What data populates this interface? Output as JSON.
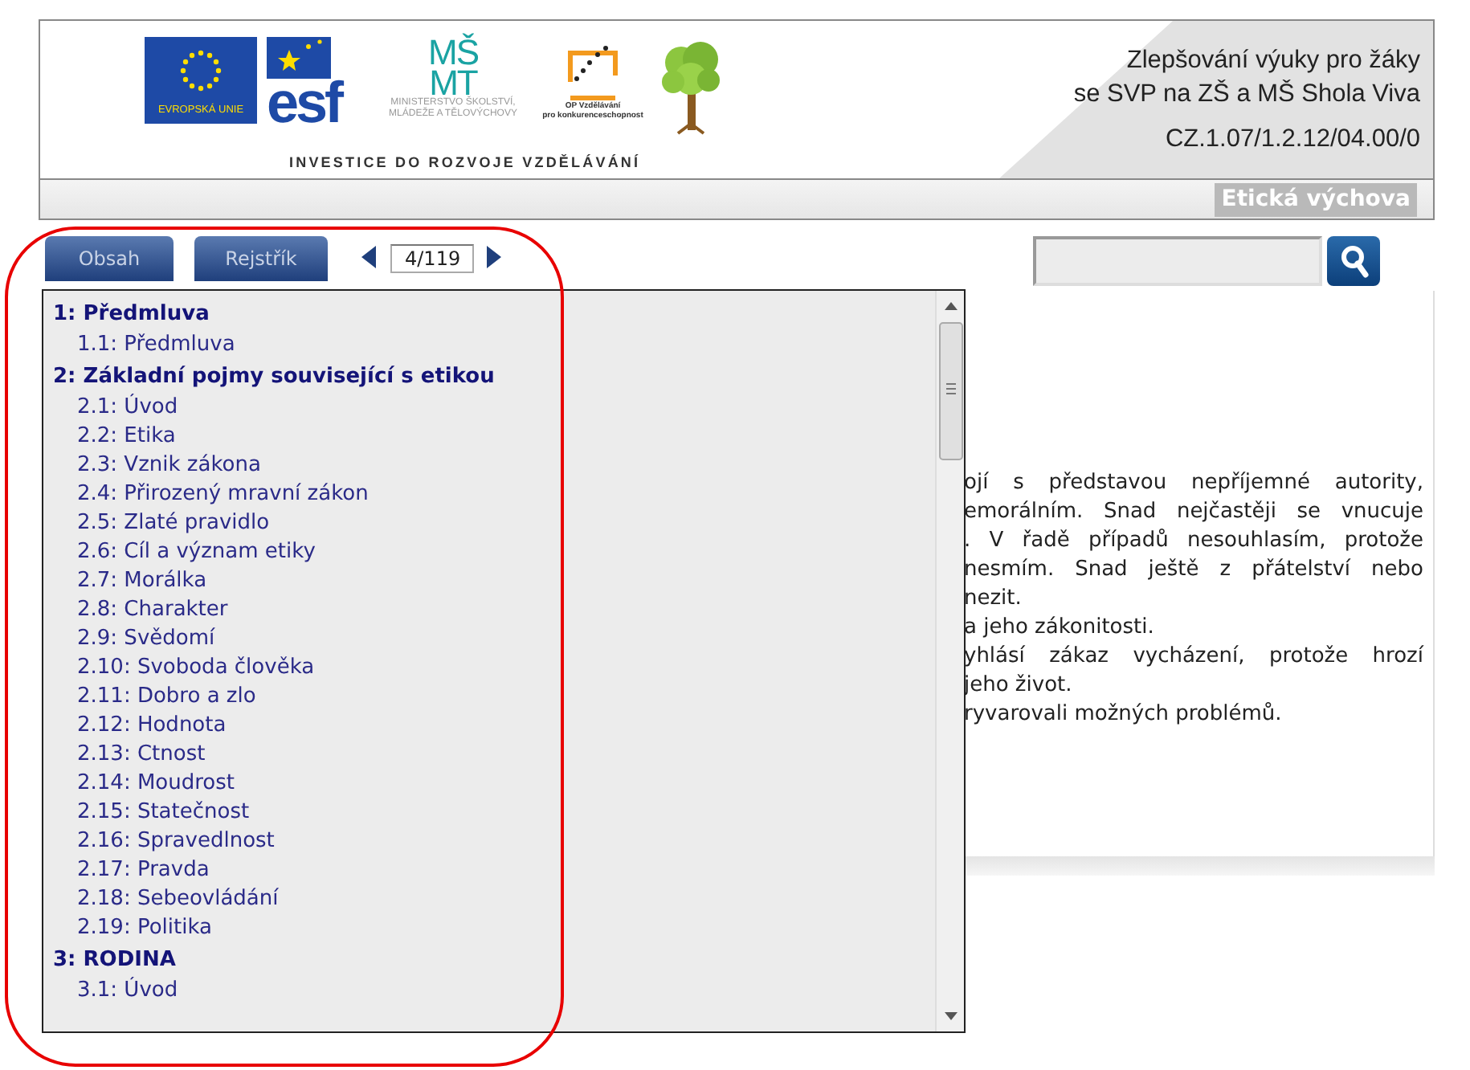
{
  "header": {
    "logos": {
      "eu_caption": "EVROPSKÁ UNIE",
      "esf_mark": "esf",
      "msmt_mark": [
        "MŠ",
        "MT"
      ],
      "msmt_caption": [
        "MINISTERSTVO ŠKOLSTVÍ,",
        "MLÁDEŽE A TĚLOVÝCHOVY"
      ],
      "op_caption": [
        "OP Vzdělávání",
        "pro konkurenceschopnost"
      ]
    },
    "slogan": "INVESTICE DO ROZVOJE VZDĚLÁVÁNÍ",
    "project_title": [
      "Zlepšování výuky pro žáky",
      "se SVP na ZŠ a MŠ Shola Viva"
    ],
    "project_code": "CZ.1.07/1.2.12/04.00/0",
    "subject": "Etická výchova"
  },
  "tabs": [
    {
      "label": "Obsah",
      "selected": false
    },
    {
      "label": "Rejstřík",
      "selected": false
    }
  ],
  "pager": {
    "value": "4/119"
  },
  "content_lines": [
    {
      "text": "ojí s představou nepříjemné autority,",
      "kind": "full"
    },
    {
      "text": "emorálním. Snad nejčastěji se vnucuje",
      "kind": "full"
    },
    {
      "text": ". V řadě případů nesouhlasím, protože",
      "kind": "full"
    },
    {
      "text": "nesmím. Snad ještě z přátelství nebo",
      "kind": "full"
    },
    {
      "text": "nezit.",
      "kind": "end"
    },
    {
      "text": "a jeho zákonitosti.",
      "kind": "end"
    },
    {
      "text": "yhlásí zákaz vycházení, protože hrozí",
      "kind": "full"
    },
    {
      "text": "jeho život.",
      "kind": "end"
    },
    {
      "text": "ryvarovali možných problémů.",
      "kind": "end"
    }
  ],
  "toc": [
    {
      "label": "1: Předmluva",
      "children": [
        {
          "label": "1.1: Předmluva"
        }
      ]
    },
    {
      "label": "2: Základní pojmy související s etikou",
      "children": [
        {
          "label": "2.1: Úvod"
        },
        {
          "label": "2.2: Etika"
        },
        {
          "label": "2.3: Vznik zákona"
        },
        {
          "label": "2.4: Přirozený mravní zákon"
        },
        {
          "label": "2.5: Zlaté pravidlo"
        },
        {
          "label": "2.6: Cíl a význam etiky"
        },
        {
          "label": "2.7: Morálka"
        },
        {
          "label": "2.8: Charakter"
        },
        {
          "label": "2.9: Svědomí"
        },
        {
          "label": "2.10: Svoboda člověka"
        },
        {
          "label": "2.11: Dobro a zlo"
        },
        {
          "label": "2.12: Hodnota"
        },
        {
          "label": "2.13: Ctnost"
        },
        {
          "label": "2.14: Moudrost"
        },
        {
          "label": "2.15: Statečnost"
        },
        {
          "label": "2.16: Spravedlnost"
        },
        {
          "label": "2.17: Pravda"
        },
        {
          "label": "2.18: Sebeovládání"
        },
        {
          "label": "2.19: Politika"
        }
      ]
    },
    {
      "label": "3: RODINA",
      "children": [
        {
          "label": "3.1: Úvod"
        }
      ]
    }
  ]
}
